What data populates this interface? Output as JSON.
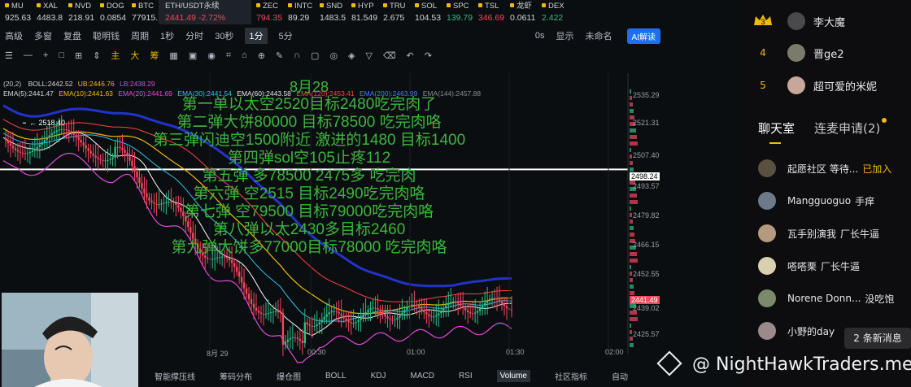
{
  "tickers": [
    {
      "sym": "MU",
      "px": "925.63",
      "color": "white"
    },
    {
      "sym": "XAL",
      "px": "4483.8",
      "color": "white"
    },
    {
      "sym": "NVD",
      "px": "218.91",
      "color": "white"
    },
    {
      "sym": "DOG",
      "px": "0.0854",
      "color": "white"
    },
    {
      "sym": "BTC",
      "px": "77915.",
      "color": "white"
    },
    {
      "sym": "ETH/USDT永续",
      "px": "2441.49 -2.72%",
      "color": "red",
      "wide": true
    },
    {
      "sym": "ZEC",
      "px": "794.35",
      "color": "red"
    },
    {
      "sym": "INTC",
      "px": "89.29",
      "color": "white"
    },
    {
      "sym": "SND",
      "px": "1483.5",
      "color": "white"
    },
    {
      "sym": "HYP",
      "px": "81.549",
      "color": "white"
    },
    {
      "sym": "TRU",
      "px": "2.675",
      "color": "white"
    },
    {
      "sym": "SOL",
      "px": "104.53",
      "color": "white"
    },
    {
      "sym": "SPC",
      "px": "139.79",
      "color": "green"
    },
    {
      "sym": "TSL",
      "px": "346.69",
      "color": "red"
    },
    {
      "sym": "龙虾",
      "px": "0.0611",
      "color": "white"
    },
    {
      "sym": "DEX",
      "px": "2.422",
      "color": "green"
    }
  ],
  "toolbar1": [
    "高级",
    "多窗",
    "复盘",
    "聪明钱",
    "周期",
    "1秒",
    "分时",
    "30秒",
    "1分",
    "5分"
  ],
  "toolbar1_active": "1分",
  "toolbar1_right": {
    "zero_s": "0s",
    "display": "显示",
    "unnamed": "未命名",
    "ai": "AI解读"
  },
  "toolbar2_labels": [
    "主",
    "大",
    "筹"
  ],
  "indicators": {
    "boll_prefix": "(20,2)",
    "boll": "BOLL:2442.52",
    "ub": "UB:2446.76",
    "lb": "LB:2438.29",
    "ema5": "EMA(5):2441.47",
    "ema10": "EMA(10):2441.63",
    "ema20": "EMA(20):2441.69",
    "ema30": "EMA(30):2441.54",
    "ema60": "EMA(60):2443.58",
    "ema120": "EMA(120):2453.41",
    "ema200": "EMA(200):2463.99",
    "ema144": "EMA(144):2457.88"
  },
  "annotations": [
    "8月28",
    "第一单以太空2520目标2480吃完肉了",
    "第二弹大饼80000 目标78500 吃完肉咯",
    "第三弹闪迪空1500附近 激进的1480 目标1400",
    "第四弹sol空105止疼112",
    "第五弹 多78500 2475多 吃完肉",
    "第六弹 空2515 目标2490吃完肉咯",
    "第七弹 空79500 目标79000吃完肉咯",
    "第八弹以太2430多目标2460",
    "第九弹大饼多77000目标78000 吃完肉咯"
  ],
  "high_marker": "2518.40",
  "price_axis": [
    "2535.29",
    "2521.31",
    "2507.40",
    "2498.24",
    "2493.57",
    "2479.82",
    "2466.15",
    "2452.55",
    "2441.49",
    "2439.02",
    "2425.57"
  ],
  "x_axis": [
    "8月 29",
    "00:30",
    "01:00",
    "01:30",
    "02:00"
  ],
  "bottom_tabs": [
    "智能撑压线",
    "筹码分布",
    "爆仓图",
    "BOLL",
    "KDJ",
    "MACD",
    "RSI",
    "Volume",
    "社区指标",
    "自动"
  ],
  "bottom_active": "Volume",
  "leaderboard": [
    {
      "rank": "3",
      "name": "李大魔"
    },
    {
      "rank": "4",
      "name": "晋ge2"
    },
    {
      "rank": "5",
      "name": "超可爱的米妮"
    }
  ],
  "tabs": {
    "chat": "聊天室",
    "apply": "连麦申请(2)"
  },
  "chat": [
    {
      "user": "起愿社区 等待...",
      "text": "已加入",
      "text_color": "yellow"
    },
    {
      "user": "Mangguoguo",
      "text": "手痒"
    },
    {
      "user": "瓦手别演我",
      "text": "厂长牛逼"
    },
    {
      "user": "嗒嗒栗",
      "text": "厂长牛逼"
    },
    {
      "user": "Norene Donn...",
      "text": "没吃饱"
    },
    {
      "user": "小野的day",
      "text": ""
    }
  ],
  "new_messages": "2 条新消息",
  "watermark": "@ NightHawkTraders.me",
  "colors": {
    "accent": "#f0b90b",
    "up": "#2ebd85",
    "down": "#f6465d",
    "annot": "#3cb53c"
  }
}
